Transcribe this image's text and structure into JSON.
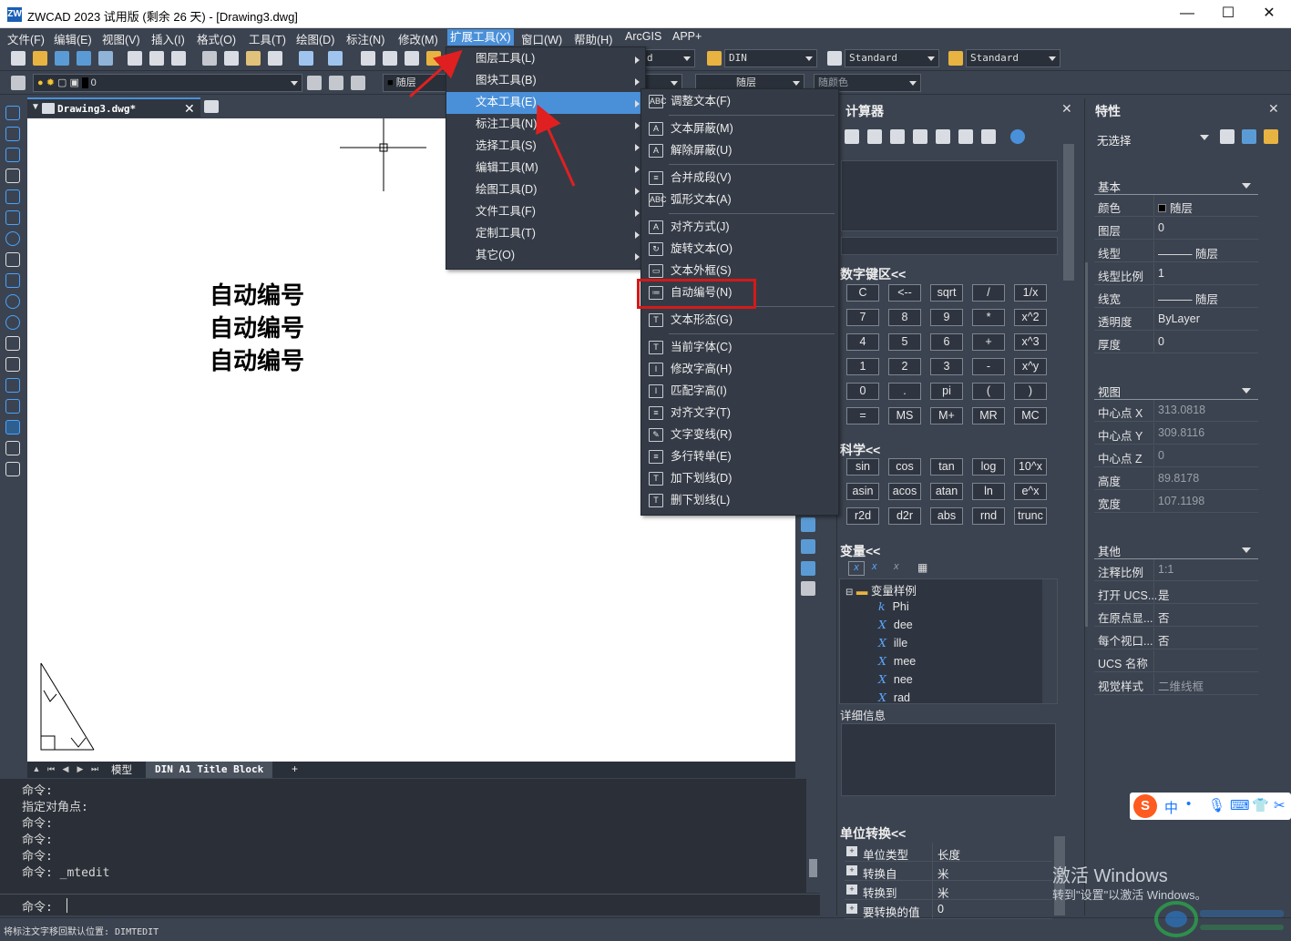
{
  "window": {
    "title": "ZWCAD 2023 试用版 (剩余 26 天) - [Drawing3.dwg]",
    "minimize": "—",
    "maximize": "☐",
    "close": "✕"
  },
  "menubar": {
    "items": [
      "文件(F)",
      "编辑(E)",
      "视图(V)",
      "插入(I)",
      "格式(O)",
      "工具(T)",
      "绘图(D)",
      "标注(N)",
      "修改(M)",
      "扩展工具(X)",
      "窗口(W)",
      "帮助(H)",
      "ArcGIS",
      "APP+"
    ],
    "active": "扩展工具(X)"
  },
  "toolbar": {
    "combo_d": "d",
    "combo_din": "DIN",
    "combo_standard1": "Standard",
    "combo_standard2": "Standard",
    "layer_combo": "0",
    "color_combo": "随层",
    "linetype_combo": "随层",
    "plotstyle_combo": "随颜色"
  },
  "doc_tab": {
    "label": "Drawing3.dwg*"
  },
  "canvas": {
    "texts": [
      "自动编号",
      "自动编号",
      "自动编号"
    ]
  },
  "layout_tabs": [
    "模型",
    "DIN A1 Title Block",
    "+"
  ],
  "command": {
    "lines": [
      "命令:",
      "指定对角点:",
      "命令:",
      "命令:",
      "命令:",
      "命令: _mtedit"
    ],
    "prompt": "命令:"
  },
  "status": "将标注文字移回默认位置: DIMTEDIT",
  "menu_ext": {
    "items": [
      "图层工具(L)",
      "图块工具(B)",
      "文本工具(E)",
      "标注工具(N)",
      "选择工具(S)",
      "编辑工具(M)",
      "绘图工具(D)",
      "文件工具(F)",
      "定制工具(T)",
      "其它(O)"
    ],
    "highlighted": "文本工具(E)"
  },
  "menu_text": {
    "groups": [
      [
        {
          "label": "调整文本(F)",
          "icon": "ABC"
        }
      ],
      [
        {
          "label": "文本屏蔽(M)",
          "icon": "A"
        },
        {
          "label": "解除屏蔽(U)",
          "icon": "A"
        }
      ],
      [
        {
          "label": "合并成段(V)",
          "icon": "≡"
        },
        {
          "label": "弧形文本(A)",
          "icon": "ABC"
        }
      ],
      [
        {
          "label": "对齐方式(J)",
          "icon": "A"
        },
        {
          "label": "旋转文本(O)",
          "icon": "↻"
        },
        {
          "label": "文本外框(S)",
          "icon": "▭"
        },
        {
          "label": "自动编号(N)",
          "icon": "≔"
        }
      ],
      [
        {
          "label": "文本形态(G)",
          "icon": "T"
        }
      ],
      [
        {
          "label": "当前字体(C)",
          "icon": "T"
        },
        {
          "label": "修改字高(H)",
          "icon": "I"
        },
        {
          "label": "匹配字高(I)",
          "icon": "I"
        },
        {
          "label": "对齐文字(T)",
          "icon": "≡"
        },
        {
          "label": "文字变线(R)",
          "icon": "✎"
        },
        {
          "label": "多行转单(E)",
          "icon": "≡"
        },
        {
          "label": "加下划线(D)",
          "icon": "T"
        },
        {
          "label": "删下划线(L)",
          "icon": "T"
        }
      ]
    ]
  },
  "calc": {
    "title": "计算器",
    "numpad_title": "数字键区<<",
    "numpad": [
      [
        "C",
        "<--",
        "sqrt",
        "/",
        "1/x"
      ],
      [
        "7",
        "8",
        "9",
        "*",
        "x^2"
      ],
      [
        "4",
        "5",
        "6",
        "+",
        "x^3"
      ],
      [
        "1",
        "2",
        "3",
        "-",
        "x^y"
      ],
      [
        "0",
        ".",
        "pi",
        "(",
        ")"
      ],
      [
        "=",
        "MS",
        "M+",
        "MR",
        "MC"
      ]
    ],
    "sci_title": "科学<<",
    "sci": [
      [
        "sin",
        "cos",
        "tan",
        "log",
        "10^x"
      ],
      [
        "asin",
        "acos",
        "atan",
        "ln",
        "e^x"
      ],
      [
        "r2d",
        "d2r",
        "abs",
        "rnd",
        "trunc"
      ]
    ],
    "var_title": "变量<<",
    "var_folder": "变量样例",
    "vars": [
      {
        "sym": "k",
        "name": "Phi"
      },
      {
        "sym": "X",
        "name": "dee"
      },
      {
        "sym": "X",
        "name": "ille"
      },
      {
        "sym": "X",
        "name": "mee"
      },
      {
        "sym": "X",
        "name": "nee"
      },
      {
        "sym": "X",
        "name": "rad"
      }
    ],
    "details_label": "详细信息",
    "unit_title": "单位转换<<",
    "unit_rows": [
      {
        "k": "单位类型",
        "v": "长度"
      },
      {
        "k": "转换自",
        "v": "米"
      },
      {
        "k": "转换到",
        "v": "米"
      },
      {
        "k": "要转换的值",
        "v": "0"
      }
    ]
  },
  "props": {
    "title": "特性",
    "selection": "无选择",
    "groups": [
      {
        "name": "基本",
        "rows": [
          {
            "k": "颜色",
            "v": "随层"
          },
          {
            "k": "图层",
            "v": "0"
          },
          {
            "k": "线型",
            "v": "——— 随层"
          },
          {
            "k": "线型比例",
            "v": "1"
          },
          {
            "k": "线宽",
            "v": "——— 随层"
          },
          {
            "k": "透明度",
            "v": "ByLayer"
          },
          {
            "k": "厚度",
            "v": "0"
          }
        ]
      },
      {
        "name": "视图",
        "rows": [
          {
            "k": "中心点 X",
            "v": "313.0818"
          },
          {
            "k": "中心点 Y",
            "v": "309.8116"
          },
          {
            "k": "中心点 Z",
            "v": "0"
          },
          {
            "k": "高度",
            "v": "89.8178"
          },
          {
            "k": "宽度",
            "v": "107.1198"
          }
        ]
      },
      {
        "name": "其他",
        "rows": [
          {
            "k": "注释比例",
            "v": "1:1"
          },
          {
            "k": "打开 UCS...",
            "v": "是"
          },
          {
            "k": "在原点显...",
            "v": "否"
          },
          {
            "k": "每个视口...",
            "v": "否"
          },
          {
            "k": "UCS 名称",
            "v": ""
          },
          {
            "k": "视觉样式",
            "v": "二维线框"
          }
        ]
      }
    ]
  },
  "ime": {
    "label": "中"
  },
  "watermark": {
    "line1": "激活 Windows",
    "line2": "转到\"设置\"以激活 Windows。"
  },
  "colors": {
    "accent": "#4a90d9",
    "highlight_box": "#d21a1a",
    "arrow": "#e02020"
  }
}
